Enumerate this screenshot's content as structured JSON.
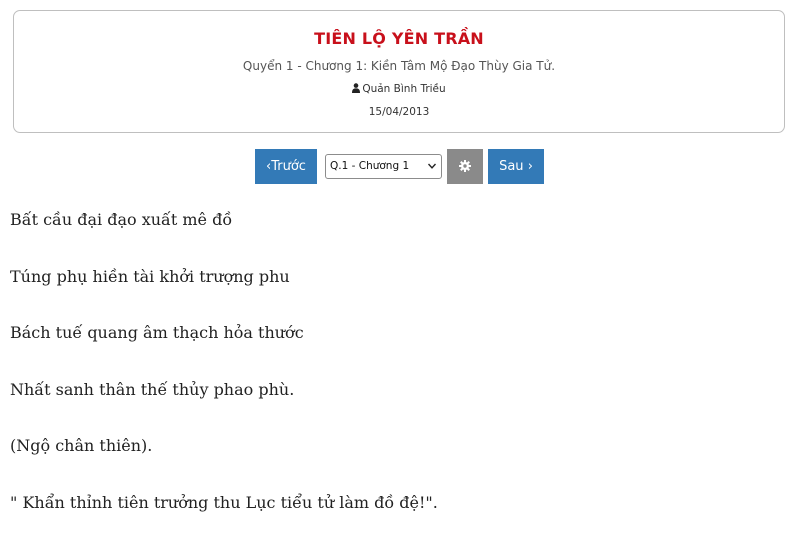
{
  "header": {
    "story_title": "TIÊN LỘ YÊN TRẦN",
    "chapter_title": "Quyển 1 - Chương 1: Kiền Tâm Mộ Đạo Thùy Gia Tử.",
    "author_icon": "user-icon",
    "author": "Quản Bình Triều",
    "date": "15/04/2013"
  },
  "nav": {
    "prev_label": "Trước",
    "prev_icon": "chevron-left-icon",
    "chapter_select_value": "Q.1 - Chương 1",
    "settings_icon": "gear-icon",
    "next_label": "Sau",
    "next_icon": "chevron-right-icon",
    "button_color": "#337ab7",
    "settings_color": "#8a8a8a"
  },
  "content": {
    "lines": [
      "Bất cầu đại đạo xuất mê đồ",
      "Túng phụ hiền tài khởi trượng phu",
      "Bách tuế quang âm thạch hỏa thước",
      "Nhất sanh thân thế thủy phao phù.",
      "(Ngộ chân thiên).",
      "\" Khẩn thỉnh tiên trưởng thu Lục tiểu tử làm đồ đệ!\"."
    ]
  },
  "colors": {
    "title_red": "#c8101b"
  }
}
